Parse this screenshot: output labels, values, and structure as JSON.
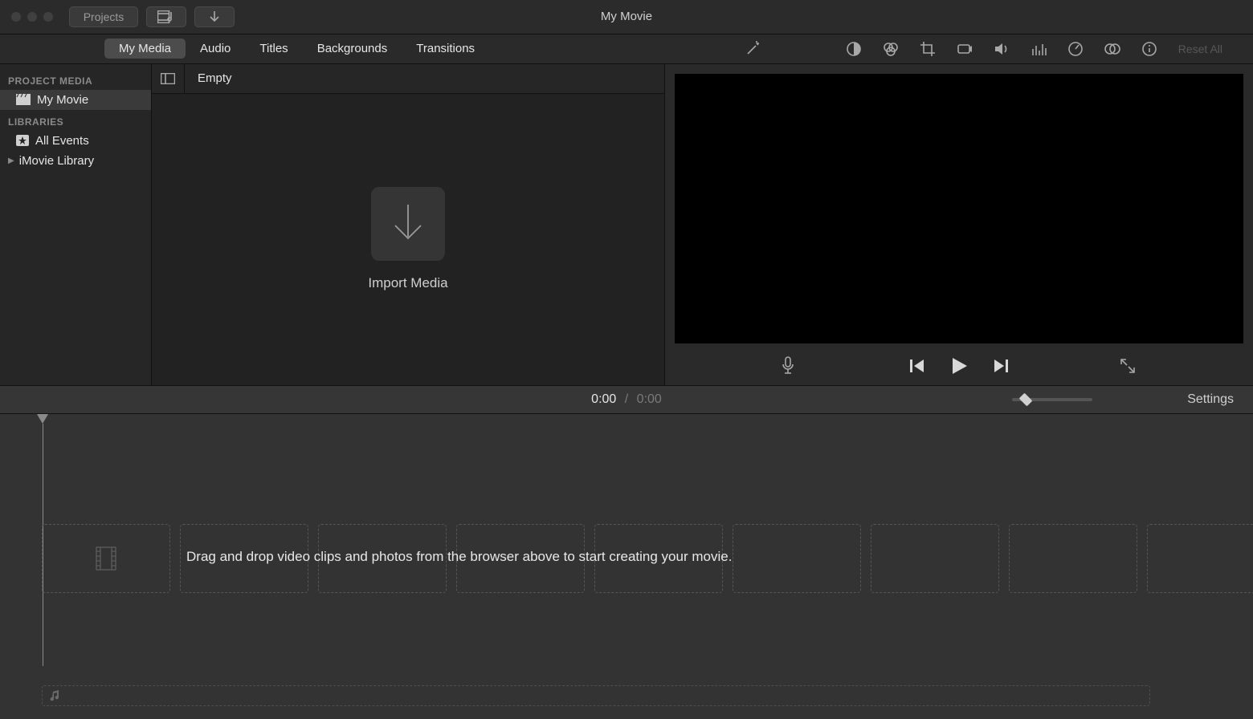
{
  "window": {
    "title": "My Movie"
  },
  "titlebar": {
    "projects_label": "Projects"
  },
  "tabs": [
    {
      "label": "My Media",
      "active": true
    },
    {
      "label": "Audio",
      "active": false
    },
    {
      "label": "Titles",
      "active": false
    },
    {
      "label": "Backgrounds",
      "active": false
    },
    {
      "label": "Transitions",
      "active": false
    }
  ],
  "adjust": {
    "reset_all": "Reset All"
  },
  "sidebar": {
    "project_media_header": "PROJECT MEDIA",
    "project_item": "My Movie",
    "libraries_header": "LIBRARIES",
    "all_events": "All Events",
    "imovie_library": "iMovie Library"
  },
  "browser": {
    "status": "Empty",
    "import_label": "Import Media"
  },
  "timecode": {
    "current": "0:00",
    "sep": "/",
    "total": "0:00"
  },
  "timebar": {
    "settings": "Settings"
  },
  "timeline": {
    "hint": "Drag and drop video clips and photos from the browser above to start creating your movie."
  }
}
